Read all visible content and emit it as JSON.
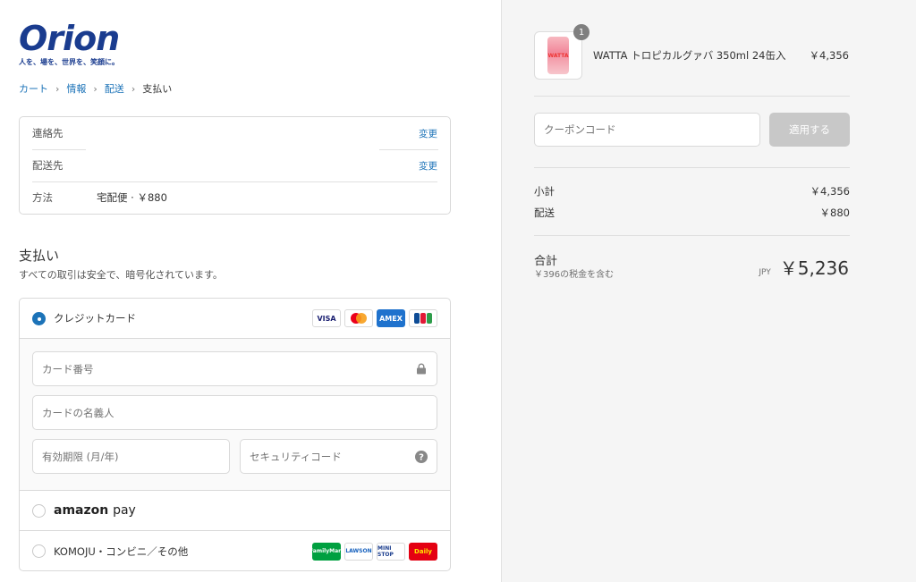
{
  "brand": {
    "logo_text": "Orion",
    "tagline": "人を、場を、世界を、笑顔に。"
  },
  "breadcrumb": [
    "カート",
    "情報",
    "配送",
    "支払い"
  ],
  "review": {
    "contact_label": "連絡先",
    "contact_change": "変更",
    "ship_to_label": "配送先",
    "ship_to_change": "変更",
    "method_label": "方法",
    "method_value": "宅配便 · ￥880"
  },
  "payment": {
    "title": "支払い",
    "subtitle": "すべての取引は安全で、暗号化されています。",
    "credit_card_label": "クレジットカード",
    "card_brands": [
      "VISA",
      "MC",
      "AMEX",
      "JCB"
    ],
    "card_number_placeholder": "カード番号",
    "name_placeholder": "カードの名義人",
    "expiry_placeholder": "有効期限 (月/年)",
    "security_placeholder": "セキュリティコード",
    "amazon_label": "amazon",
    "amazon_pay": "pay",
    "komoju_label": "KOMOJU・コンビニ／その他",
    "konbini_brands": [
      "FamilyMart",
      "LAWSON",
      "MINI STOP",
      "Daily"
    ]
  },
  "order": {
    "quantity": "1",
    "product_name": "WATTA トロピカルグァバ 350ml 24缶入",
    "product_price": "￥4,356",
    "can_label": "WATTA",
    "coupon_placeholder": "クーポンコード",
    "apply_label": "適用する",
    "subtotal_label": "小計",
    "subtotal_value": "￥4,356",
    "shipping_label": "配送",
    "shipping_value": "￥880",
    "total_label": "合計",
    "tax_note": "￥396の税金を含む",
    "currency": "JPY",
    "total_value": "￥5,236"
  }
}
